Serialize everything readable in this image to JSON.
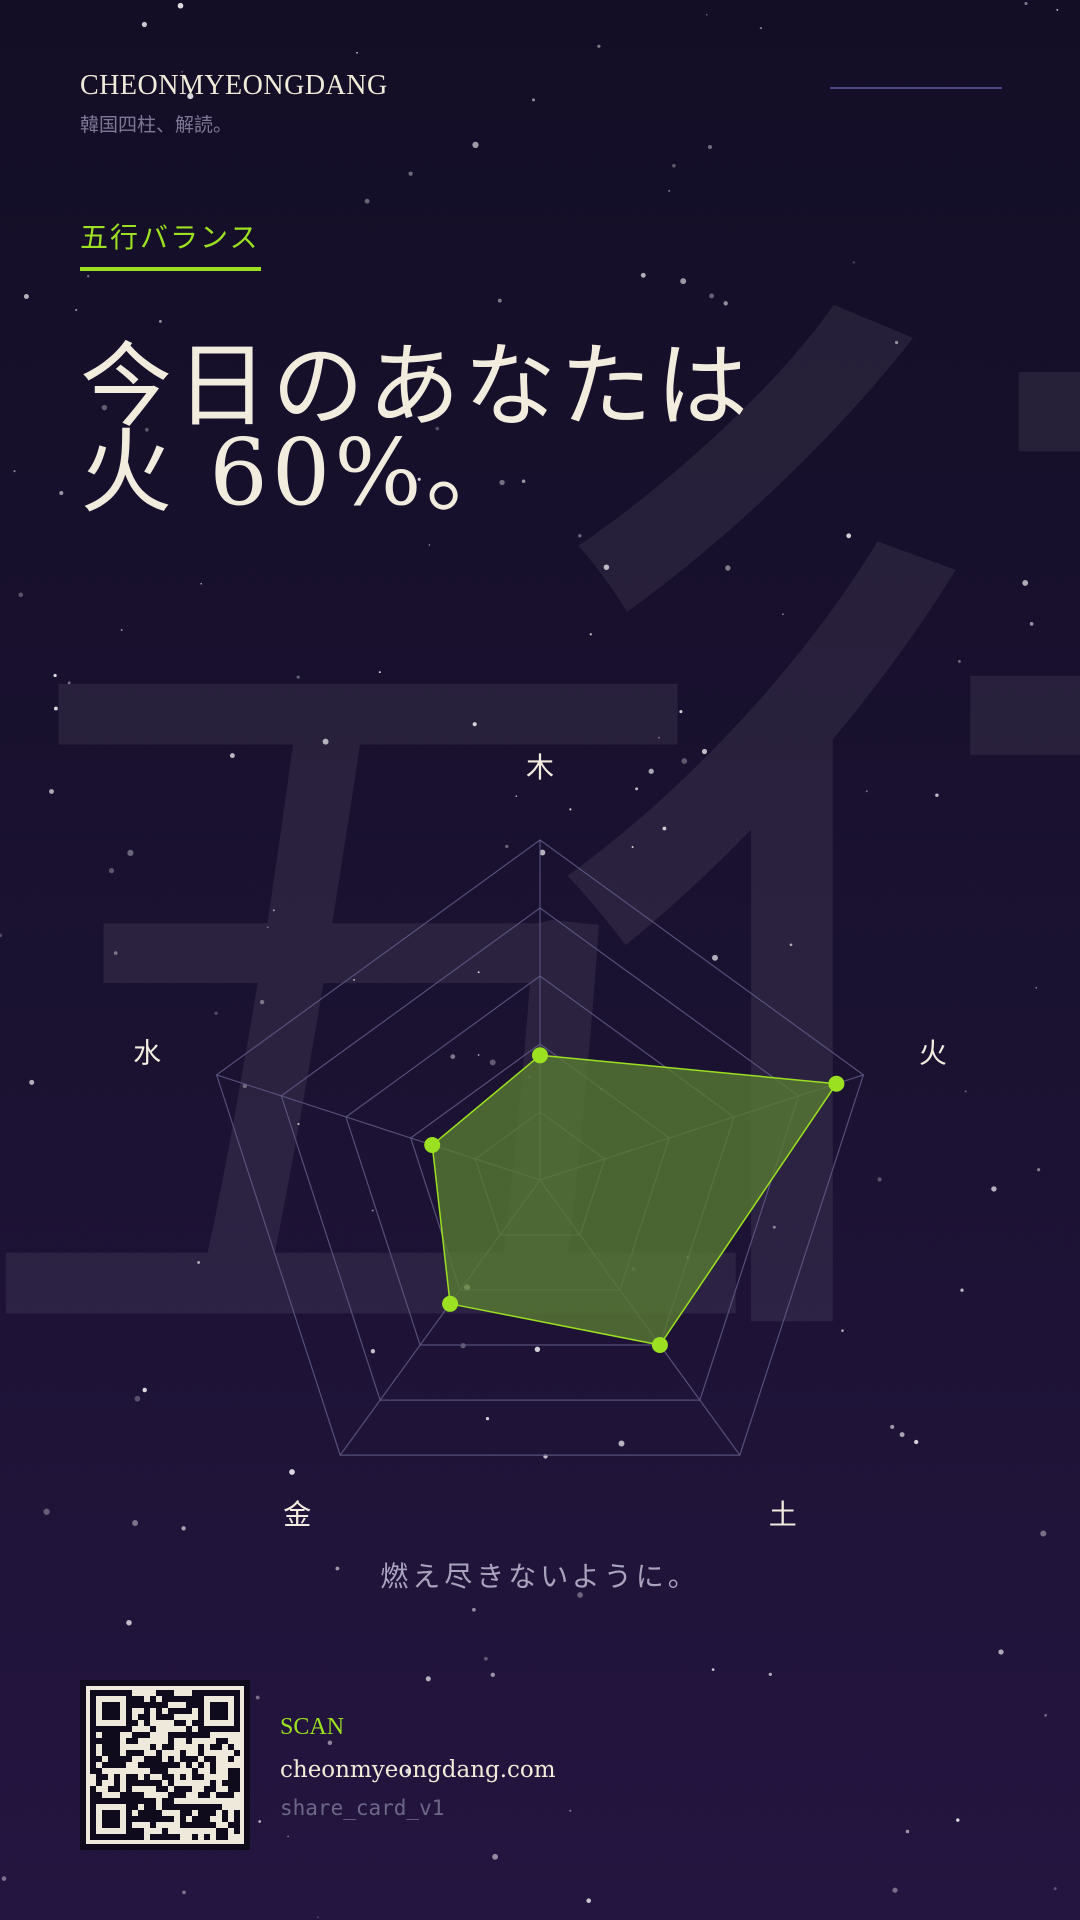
{
  "brand": {
    "name": "CHEONMYEONGDANG",
    "subtitle": "韓国四柱、解読。"
  },
  "section": {
    "label": "五行バランス"
  },
  "headline": {
    "line1": "今日のあなたは",
    "line2": "火 60%。"
  },
  "background_kanji": [
    "五",
    "行"
  ],
  "tagline": "燃え尽きないように。",
  "footer": {
    "scan_label": "SCAN",
    "url": "cheonmyeongdang.com",
    "card_id": "share_card_v1"
  },
  "colors": {
    "accent": "#9be021",
    "text": "#f2ecdf",
    "muted": "#a9a3bd",
    "grid": "#5f5a85",
    "fill": "#587a32"
  },
  "chart_data": {
    "type": "radar",
    "title": "",
    "axes": [
      "木",
      "火",
      "土",
      "金",
      "水"
    ],
    "range": [
      0,
      60
    ],
    "grid_rings": [
      12,
      24,
      36,
      48,
      60
    ],
    "series": [
      {
        "values": [
          22,
          55,
          36,
          27,
          20
        ]
      }
    ]
  }
}
